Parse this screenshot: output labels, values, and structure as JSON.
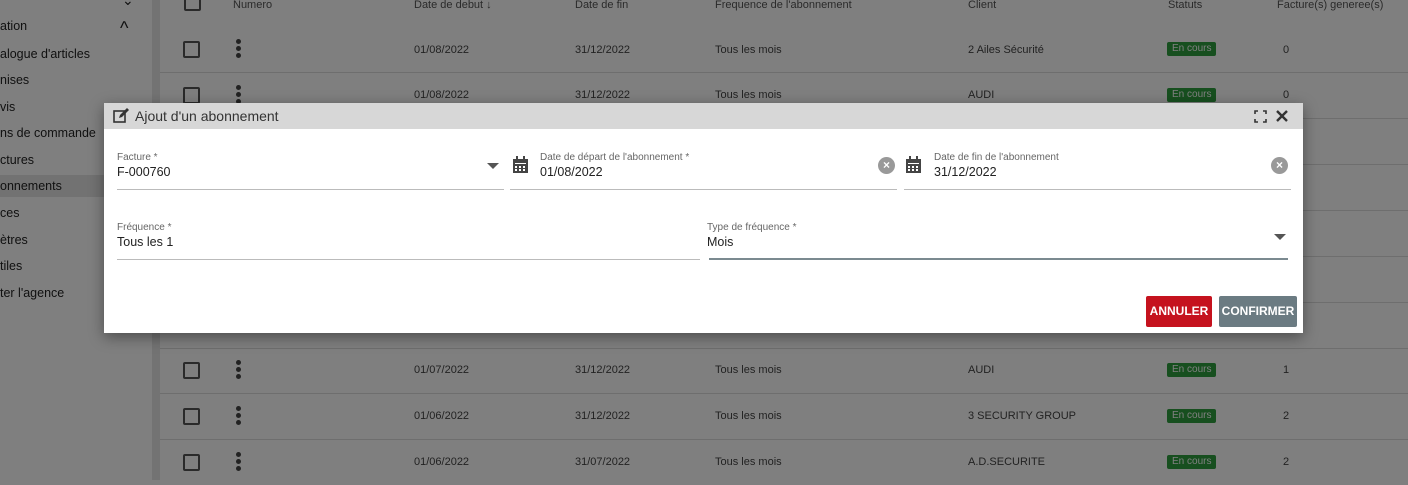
{
  "sidebar": {
    "items": [
      {
        "label": "ation"
      },
      {
        "label": "alogue d'articles"
      },
      {
        "label": "nises"
      },
      {
        "label": "vis"
      },
      {
        "label": "ns de commande"
      },
      {
        "label": "ctures"
      },
      {
        "label": "onnements"
      },
      {
        "label": "ces"
      },
      {
        "label": "ètres"
      },
      {
        "label": "tiles"
      },
      {
        "label": "ter l'agence"
      }
    ]
  },
  "table": {
    "headers": [
      "Numero",
      "Date de debut ↓",
      "Date de fin",
      "Frequence de l'abonnement",
      "Client",
      "Statuts",
      "Facture(s) generee(s)"
    ],
    "rows": [
      {
        "start": "01/08/2022",
        "end": "31/12/2022",
        "freq": "Tous les mois",
        "client": "2 Ailes Sécurité",
        "status": "En cours",
        "count": "0"
      },
      {
        "start": "01/08/2022",
        "end": "31/12/2022",
        "freq": "Tous les mois",
        "client": "AUDI",
        "status": "En cours",
        "count": "0"
      },
      {
        "start": "01/07/2022",
        "end": "31/12/2022",
        "freq": "Tous les mois",
        "client": "AUDI",
        "status": "En cours",
        "count": "1"
      },
      {
        "start": "01/06/2022",
        "end": "31/12/2022",
        "freq": "Tous les mois",
        "client": "3 SECURITY GROUP",
        "status": "En cours",
        "count": "2"
      },
      {
        "start": "01/06/2022",
        "end": "31/07/2022",
        "freq": "Tous les mois",
        "client": "A.D.SECURITE",
        "status": "En cours",
        "count": "2"
      }
    ]
  },
  "modal": {
    "title": "Ajout d'un abonnement",
    "facture": {
      "label": "Facture *",
      "value": "F-000760"
    },
    "date_depart": {
      "label": "Date de départ de l'abonnement *",
      "value": "01/08/2022"
    },
    "date_fin": {
      "label": "Date de fin de l'abonnement",
      "value": "31/12/2022"
    },
    "frequence": {
      "label": "Fréquence *",
      "value": "Tous les 1"
    },
    "type_frequence": {
      "label": "Type de fréquence *",
      "value": "Mois"
    },
    "cancel_label": "ANNULER",
    "confirm_label": "CONFIRMER"
  },
  "colors": {
    "cancel": "#c5121e",
    "confirm": "#6b7b82",
    "status_badge": "#2e9e3e"
  }
}
